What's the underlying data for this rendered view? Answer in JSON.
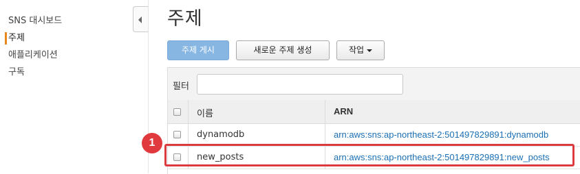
{
  "sidebar": {
    "items": [
      {
        "label": "SNS 대시보드",
        "active": false
      },
      {
        "label": "주제",
        "active": true
      },
      {
        "label": "애플리케이션",
        "active": false
      },
      {
        "label": "구독",
        "active": false
      }
    ],
    "active_color": "#e7881c"
  },
  "main": {
    "title": "주제",
    "buttons": {
      "publish": "주제 게시",
      "create": "새로운 주제 생성",
      "actions": "작업"
    },
    "filter": {
      "label": "필터",
      "value": ""
    },
    "table": {
      "columns": [
        "이름",
        "ARN"
      ],
      "rows": [
        {
          "name": "dynamodb",
          "arn": "arn:aws:sns:ap-northeast-2:501497829891:dynamodb"
        },
        {
          "name": "new_posts",
          "arn": "arn:aws:sns:ap-northeast-2:501497829891:new_posts"
        }
      ]
    }
  },
  "annotation": {
    "marker": "1",
    "color": "#dc3a3e"
  }
}
